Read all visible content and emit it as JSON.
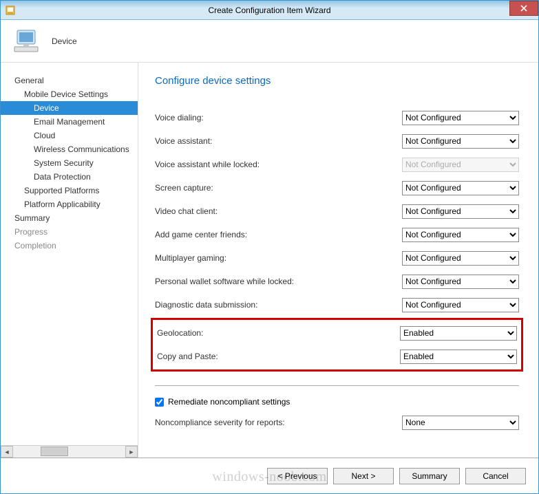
{
  "window": {
    "title": "Create Configuration Item Wizard"
  },
  "header": {
    "title": "Device"
  },
  "sidebar": {
    "items": [
      {
        "label": "General",
        "level": 0
      },
      {
        "label": "Mobile Device Settings",
        "level": 1
      },
      {
        "label": "Device",
        "level": 2,
        "selected": true
      },
      {
        "label": "Email Management",
        "level": 2
      },
      {
        "label": "Cloud",
        "level": 2
      },
      {
        "label": "Wireless Communications",
        "level": 2
      },
      {
        "label": "System Security",
        "level": 2
      },
      {
        "label": "Data Protection",
        "level": 2
      },
      {
        "label": "Supported Platforms",
        "level": 1
      },
      {
        "label": "Platform Applicability",
        "level": 1
      },
      {
        "label": "Summary",
        "level": 0
      },
      {
        "label": "Progress",
        "level": 0,
        "disabled": true
      },
      {
        "label": "Completion",
        "level": 0,
        "disabled": true
      }
    ]
  },
  "main": {
    "heading": "Configure device settings",
    "settings": [
      {
        "label": "Voice dialing:",
        "value": "Not Configured",
        "disabled": false
      },
      {
        "label": "Voice assistant:",
        "value": "Not Configured",
        "disabled": false
      },
      {
        "label": "Voice assistant while locked:",
        "value": "Not Configured",
        "disabled": true
      },
      {
        "label": "Screen capture:",
        "value": "Not Configured",
        "disabled": false
      },
      {
        "label": "Video chat client:",
        "value": "Not Configured",
        "disabled": false
      },
      {
        "label": "Add game center friends:",
        "value": "Not Configured",
        "disabled": false
      },
      {
        "label": "Multiplayer gaming:",
        "value": "Not Configured",
        "disabled": false
      },
      {
        "label": "Personal wallet software while locked:",
        "value": "Not Configured",
        "disabled": false
      },
      {
        "label": "Diagnostic data submission:",
        "value": "Not Configured",
        "disabled": false
      }
    ],
    "highlighted_settings": [
      {
        "label": "Geolocation:",
        "value": "Enabled",
        "disabled": false
      },
      {
        "label": "Copy and Paste:",
        "value": "Enabled",
        "disabled": false
      }
    ],
    "remediate": {
      "label": "Remediate noncompliant settings",
      "checked": true
    },
    "noncompliance": {
      "label": "Noncompliance severity for reports:",
      "value": "None"
    }
  },
  "footer": {
    "previous": "< Previous",
    "next": "Next >",
    "summary": "Summary",
    "cancel": "Cancel"
  },
  "watermark": "windows-noob.com"
}
